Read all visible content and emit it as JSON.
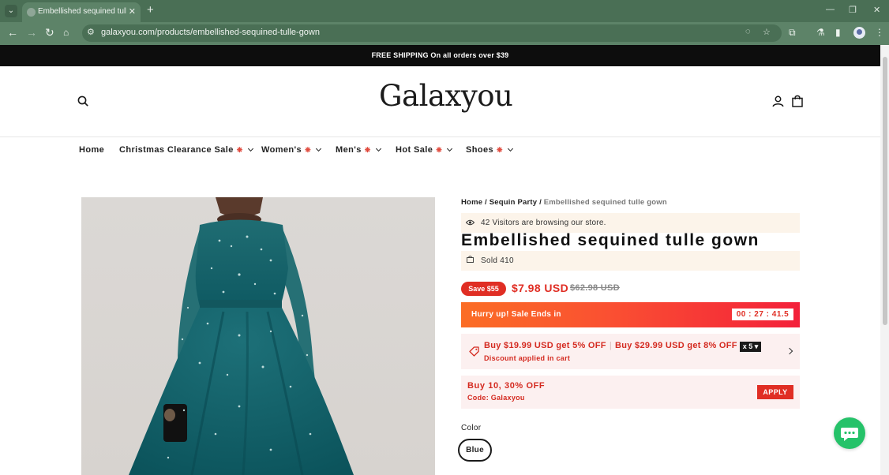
{
  "browser": {
    "tab_title": "Embellished sequined tulle gown",
    "url": "galaxyou.com/products/embellished-sequined-tulle-gown",
    "new_tab_label": "+",
    "tab_close_label": "✕",
    "window_controls": [
      "—",
      "❐",
      "✕"
    ]
  },
  "announcement": "FREE SHIPPING On all orders over $39",
  "header": {
    "logo": "Galaxyou"
  },
  "nav": {
    "items": [
      {
        "label": "Home",
        "hot": false,
        "dropdown": false
      },
      {
        "label": "Christmas Clearance Sale",
        "hot": true,
        "dropdown": true
      },
      {
        "label": "Women's",
        "hot": true,
        "dropdown": true
      },
      {
        "label": "Men's",
        "hot": true,
        "dropdown": true
      },
      {
        "label": "Hot Sale",
        "hot": true,
        "dropdown": true
      },
      {
        "label": "Shoes",
        "hot": true,
        "dropdown": true
      }
    ],
    "hot_glyph": "❋"
  },
  "breadcrumb": {
    "home": "Home",
    "separator": "/",
    "collection": "Sequin Party",
    "current": "Embellished sequined tulle gown"
  },
  "product": {
    "visitors_text": "42 Visitors are browsing our store.",
    "title": "Embellished sequined tulle gown",
    "sold_text": "Sold 410",
    "save_badge": "Save $55",
    "price": "$7.98 USD",
    "compare_price": "$62.98 USD"
  },
  "countdown": {
    "label": "Hurry up! Sale Ends in",
    "time": "00 : 27 : 41.5"
  },
  "discount": {
    "tier1": "Buy $19.99 USD get 5% OFF",
    "tier2": "Buy $29.99 USD get 8% OFF",
    "separator": "|",
    "quantity_badge": "x 5 ▾",
    "sub": "Discount applied in cart"
  },
  "coupon": {
    "title": "Buy 10, 30% OFF",
    "code": "Code: Galaxyou",
    "apply_label": "APPLY"
  },
  "options": {
    "color_label": "Color",
    "selected_color": "Blue"
  },
  "colors": {
    "accent_red": "#e02e24",
    "announcement_bg": "#0d0d0d",
    "chat_green": "#25c269",
    "chrome_green": "#5d8368"
  }
}
